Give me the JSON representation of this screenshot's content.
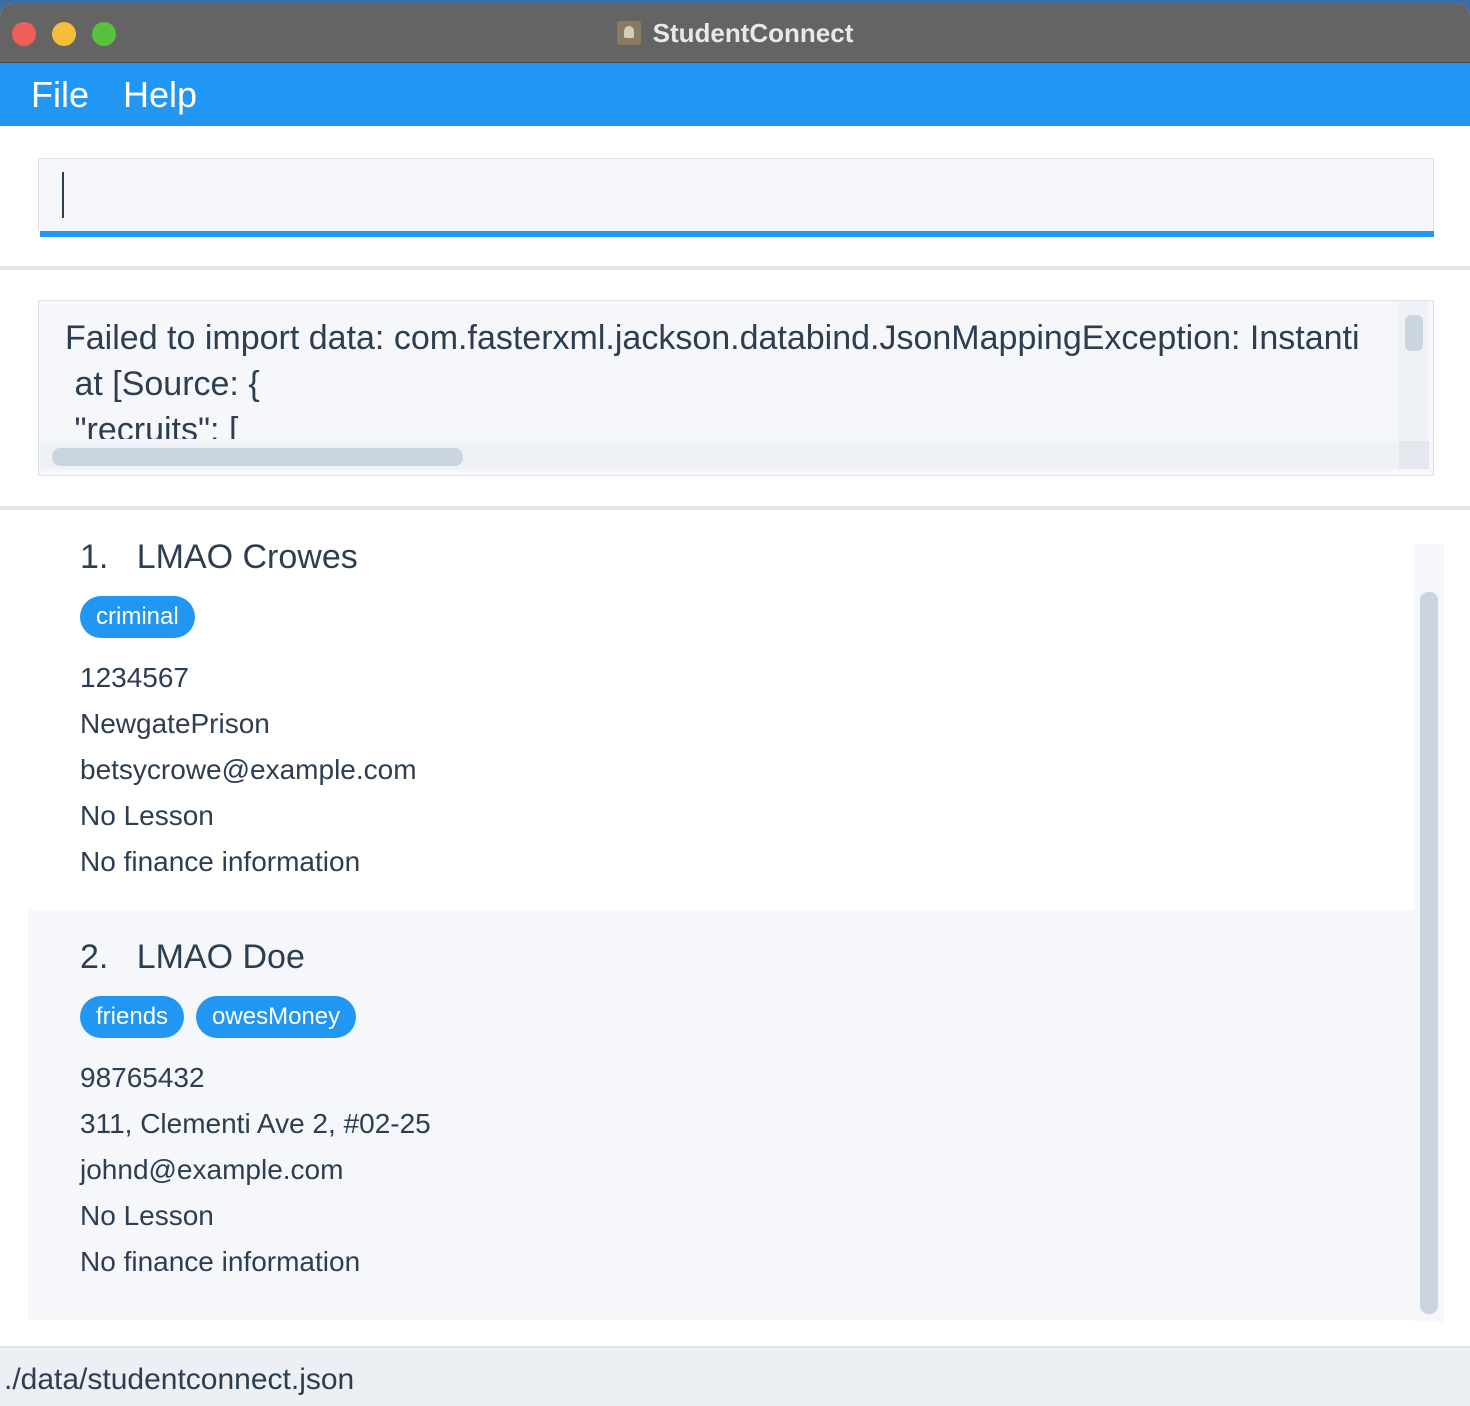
{
  "window": {
    "title": "StudentConnect"
  },
  "menu": {
    "file_label": "File",
    "help_label": "Help"
  },
  "command": {
    "value": ""
  },
  "result": {
    "lines": [
      "Failed to import data: com.fasterxml.jackson.databind.JsonMappingException: Instanti",
      " at [Source: {",
      " \"recruits\": ["
    ]
  },
  "persons": [
    {
      "index": "1.",
      "name": "LMAO Crowes",
      "tags": [
        "criminal"
      ],
      "phone": "1234567",
      "address": "NewgatePrison",
      "email": "betsycrowe@example.com",
      "lesson": "No Lesson",
      "finance": "No finance information"
    },
    {
      "index": "2.",
      "name": "LMAO Doe",
      "tags": [
        "friends",
        "owesMoney"
      ],
      "phone": "98765432",
      "address": "311, Clementi Ave 2, #02-25",
      "email": "johnd@example.com",
      "lesson": "No Lesson",
      "finance": "No finance information"
    }
  ],
  "status": {
    "file_path": "./data/studentconnect.json"
  },
  "colors": {
    "accent": "#2196f3",
    "titlebar": "#646464",
    "text": "#2c3e50",
    "close": "#ee5f57",
    "minimize": "#f6bd3b",
    "maximize": "#5ac13f"
  }
}
